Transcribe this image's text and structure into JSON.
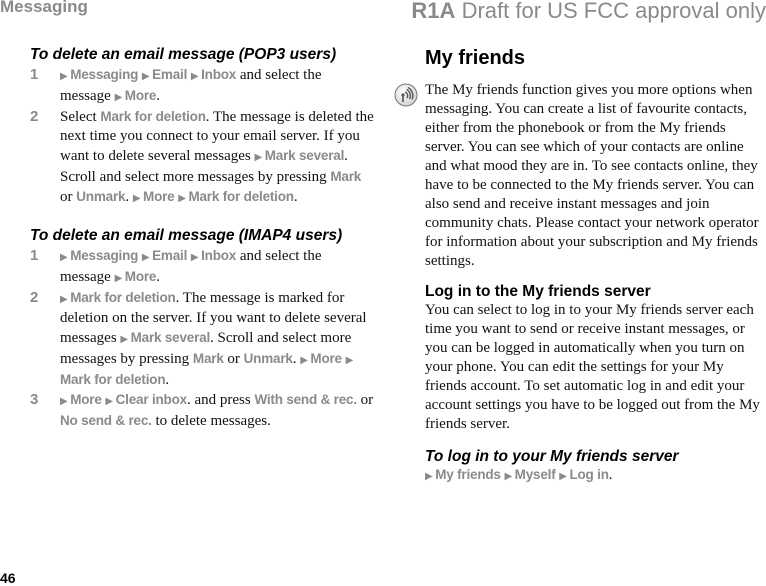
{
  "header": {
    "section": "Messaging",
    "model": "R1A",
    "draft_note": "Draft for US FCC approval only"
  },
  "left": {
    "pop3": {
      "heading": "To delete an email message (POP3 users)",
      "steps": [
        {
          "num": "1",
          "parts": [
            {
              "t": "nav",
              "v": "Messaging"
            },
            {
              "t": "nav",
              "v": "Email"
            },
            {
              "t": "nav",
              "v": "Inbox"
            },
            {
              "t": "text",
              "v": " and select the message "
            },
            {
              "t": "nav",
              "v": "More"
            },
            {
              "t": "text",
              "v": "."
            }
          ]
        },
        {
          "num": "2",
          "parts": [
            {
              "t": "text",
              "v": "Select "
            },
            {
              "t": "key",
              "v": "Mark for deletion"
            },
            {
              "t": "text",
              "v": ". The message is deleted the next time you connect to your email server. If you want to delete several messages "
            },
            {
              "t": "nav",
              "v": "Mark several"
            },
            {
              "t": "text",
              "v": ". Scroll and select more messages by pressing "
            },
            {
              "t": "key",
              "v": "Mark"
            },
            {
              "t": "text",
              "v": " or "
            },
            {
              "t": "key",
              "v": "Unmark"
            },
            {
              "t": "text",
              "v": ". "
            },
            {
              "t": "nav",
              "v": "More"
            },
            {
              "t": "nav",
              "v": "Mark for deletion"
            },
            {
              "t": "text",
              "v": "."
            }
          ]
        }
      ]
    },
    "imap4": {
      "heading": "To delete an email message (IMAP4 users)",
      "steps": [
        {
          "num": "1",
          "parts": [
            {
              "t": "nav",
              "v": "Messaging"
            },
            {
              "t": "nav",
              "v": "Email"
            },
            {
              "t": "nav",
              "v": "Inbox"
            },
            {
              "t": "text",
              "v": " and select the message "
            },
            {
              "t": "nav",
              "v": "More"
            },
            {
              "t": "text",
              "v": "."
            }
          ]
        },
        {
          "num": "2",
          "parts": [
            {
              "t": "nav",
              "v": "Mark for deletion"
            },
            {
              "t": "text",
              "v": ". The message is marked for deletion on the server. If you want to delete several messages "
            },
            {
              "t": "nav",
              "v": "Mark several"
            },
            {
              "t": "text",
              "v": ". Scroll and select more messages by pressing "
            },
            {
              "t": "key",
              "v": "Mark"
            },
            {
              "t": "text",
              "v": " or "
            },
            {
              "t": "key",
              "v": "Unmark"
            },
            {
              "t": "text",
              "v": ". "
            },
            {
              "t": "nav",
              "v": "More"
            },
            {
              "t": "nav",
              "v": "Mark for deletion"
            },
            {
              "t": "text",
              "v": "."
            }
          ]
        },
        {
          "num": "3",
          "parts": [
            {
              "t": "nav",
              "v": "More"
            },
            {
              "t": "nav",
              "v": "Clear inbox"
            },
            {
              "t": "text",
              "v": ". and press "
            },
            {
              "t": "key",
              "v": "With send & rec."
            },
            {
              "t": "text",
              "v": " or "
            },
            {
              "t": "key",
              "v": "No send & rec."
            },
            {
              "t": "text",
              "v": " to delete messages."
            }
          ]
        }
      ]
    }
  },
  "right": {
    "title": "My friends",
    "icon": "operator-service-icon",
    "intro": "The My friends function gives you more options when messaging. You can create a list of favourite contacts, either from the phonebook or from the My friends server. You can see which of your contacts are online and what mood they are in. To see contacts online, they have to be connected to the My friends server. You can also send and receive instant messages and join community chats. Please contact your network operator for information about your subscription and My friends settings.",
    "login_heading": "Log in to the My friends server",
    "login_text": "You can select to log in to your My friends server each time you want to send or receive instant messages, or you can be logged in automatically when you turn on your phone. You can edit the settings for your My friends account. To set automatic log in and edit your account settings you have to be logged out from the My friends server.",
    "howto_heading": "To log in to your My friends server",
    "howto_path": [
      {
        "t": "nav",
        "v": "My friends"
      },
      {
        "t": "nav",
        "v": "Myself"
      },
      {
        "t": "nav",
        "v": "Log in"
      },
      {
        "t": "text",
        "v": "."
      }
    ]
  },
  "footer": {
    "page_number": "46"
  },
  "colors": {
    "menu_gray": "#8a8a8a",
    "text": "#111111"
  }
}
